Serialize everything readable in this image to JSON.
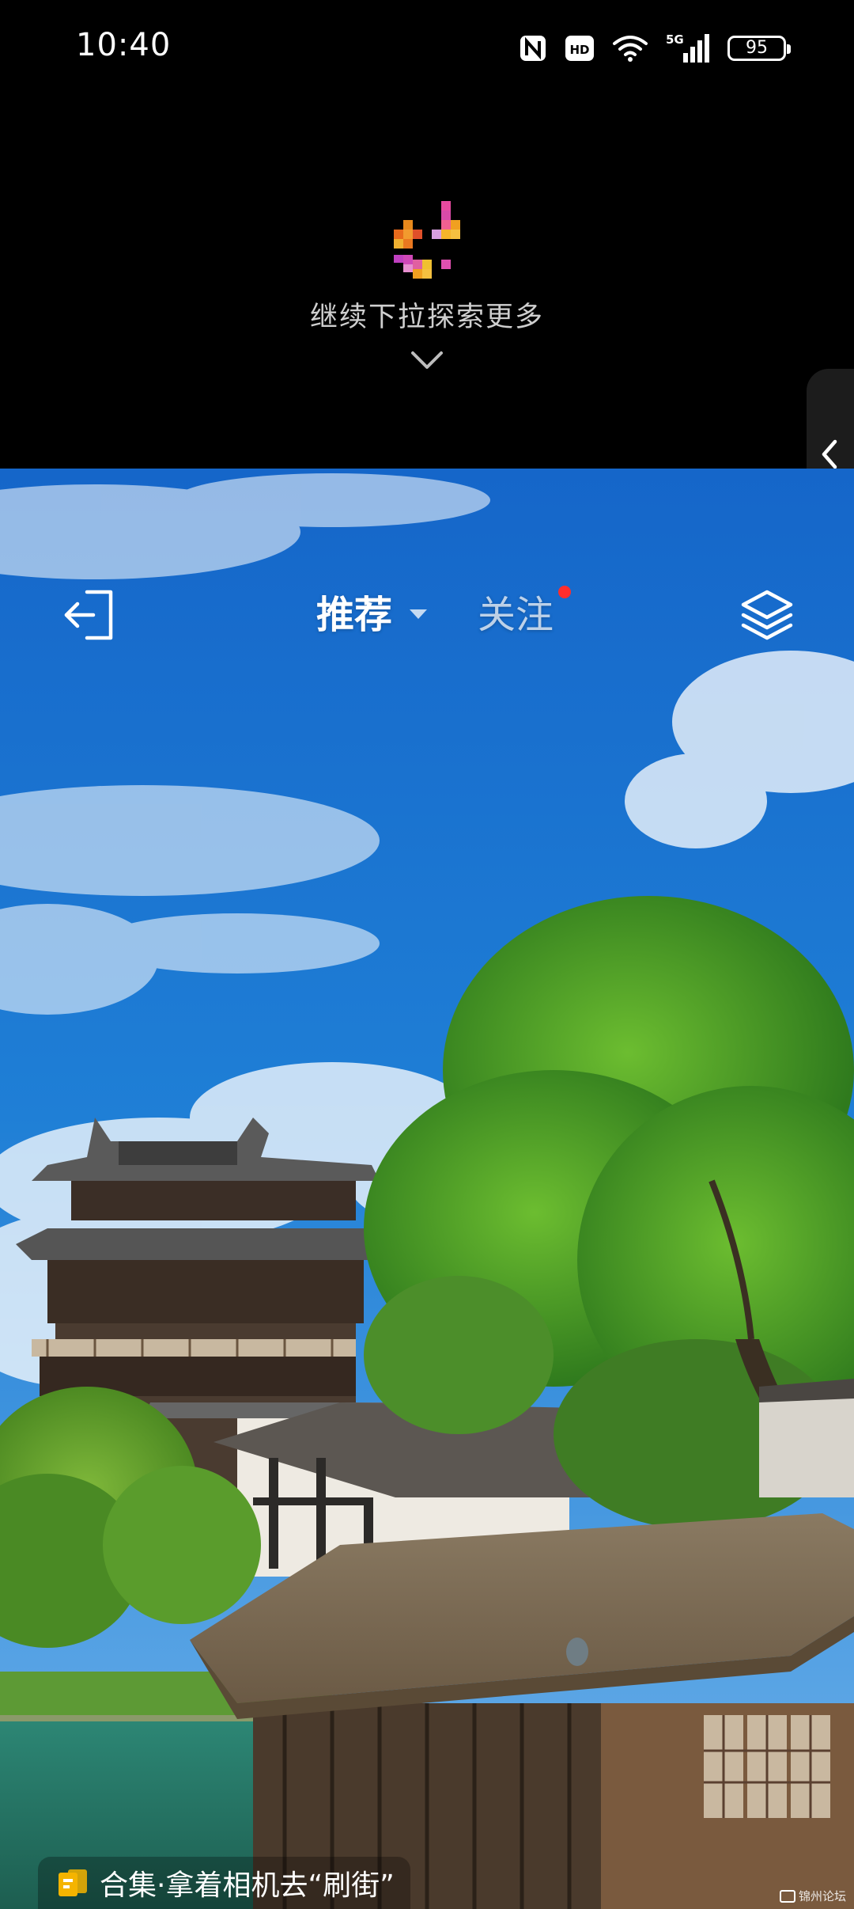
{
  "status_bar": {
    "time": "10:40",
    "icons": [
      "nfc-icon",
      "hd-icon",
      "wifi-icon",
      "signal-5g-icon"
    ],
    "network": "5G",
    "hd": "HD",
    "battery": "95"
  },
  "pull_hint": {
    "text": "继续下拉探索更多",
    "icons": [
      "app-logo-icon",
      "chevron-down-icon"
    ]
  },
  "side_handle": {
    "icon": "chevron-left-icon"
  },
  "tabs": {
    "recommend": "推荐",
    "follow": "关注",
    "follow_has_new": true,
    "icons": [
      "exit-icon",
      "dropdown-caret-icon",
      "layers-icon"
    ]
  },
  "collection": {
    "text": "合集·拿着相机去“刷街”",
    "icon": "collection-icon"
  },
  "watermark": {
    "text": "锦州论坛"
  },
  "colors": {
    "sky_top": "#1565c8",
    "sky_bottom": "#62a9e8",
    "notification_dot": "#ff2d2d",
    "collection_icon": "#f4b400"
  }
}
